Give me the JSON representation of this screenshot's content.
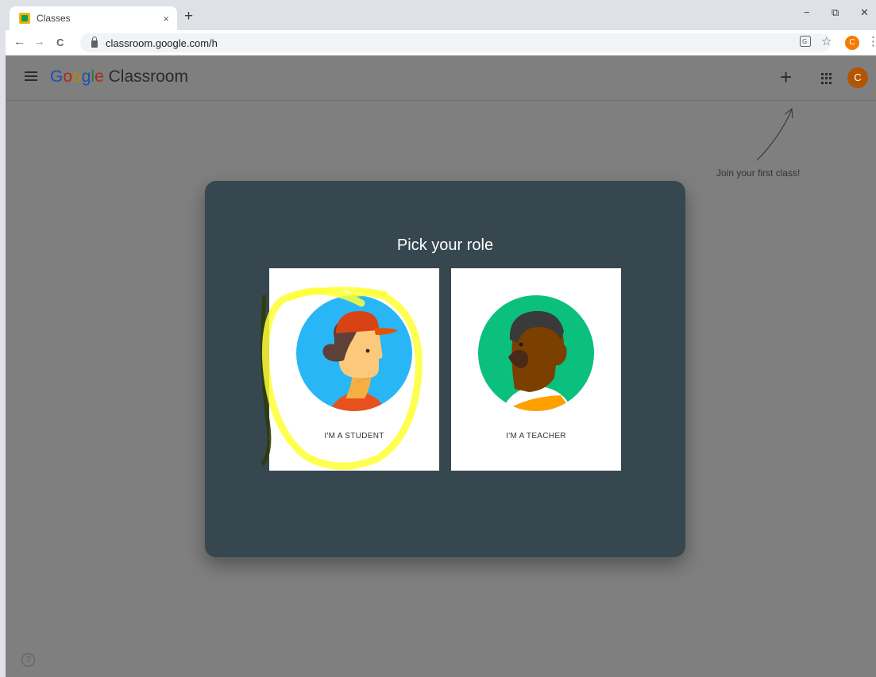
{
  "browser": {
    "tab_title": "Classes",
    "tab_close": "×",
    "new_tab": "+",
    "url": "classroom.google.com/h",
    "nav_back": "←",
    "nav_forward": "→",
    "nav_reload": "C",
    "star": "☆",
    "menu": "⋮",
    "profile_initial": "C",
    "win_minimize": "−",
    "win_restore": "⧉",
    "win_close": "✕"
  },
  "app": {
    "brand_google": [
      "G",
      "o",
      "o",
      "g",
      "l",
      "e"
    ],
    "brand_product": "Classroom",
    "plus": "+",
    "avatar_initial": "C",
    "hint": "Join your first class!",
    "help": "?"
  },
  "dialog": {
    "title": "Pick your role",
    "student_label": "I'M A STUDENT",
    "teacher_label": "I'M A TEACHER"
  },
  "colors": {
    "student_bg": "#29b6f6",
    "teacher_bg": "#0bbf7d",
    "highlight": "#ffff33"
  }
}
